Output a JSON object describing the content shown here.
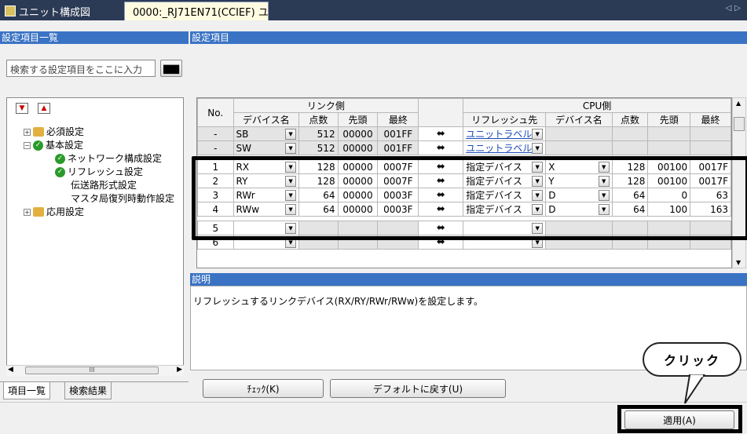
{
  "tabs": [
    {
      "label": "ユニット構成図"
    },
    {
      "label": "0000:_RJ71EN71(CCIEF) ユ..."
    }
  ],
  "left": {
    "header": "設定項目一覧",
    "search_placeholder": "検索する設定項目をここに入力",
    "tree": [
      {
        "label": "必須設定"
      },
      {
        "label": "基本設定"
      },
      {
        "label": "ネットワーク構成設定"
      },
      {
        "label": "リフレッシュ設定"
      },
      {
        "label": "伝送路形式設定"
      },
      {
        "label": "マスタ局復列時動作設定"
      },
      {
        "label": "応用設定"
      }
    ],
    "bottom_tabs": [
      "項目一覧",
      "検索結果"
    ],
    "hscroll_label": "III"
  },
  "right": {
    "header": "設定項目",
    "table": {
      "no_header": "No.",
      "link_header": "リンク側",
      "cpu_header": "CPU側",
      "sub_headers": [
        "デバイス名",
        "点数",
        "先頭",
        "最終",
        "リフレッシュ先",
        "デバイス名",
        "点数",
        "先頭",
        "最終"
      ],
      "fixed_rows": [
        {
          "no": "-",
          "dev": "SB",
          "pts": "512",
          "start": "00000",
          "end": "001FF",
          "dest": "ユニットラベル"
        },
        {
          "no": "-",
          "dev": "SW",
          "pts": "512",
          "start": "00000",
          "end": "001FF",
          "dest": "ユニットラベル"
        }
      ],
      "rows": [
        {
          "no": "1",
          "dev": "RX",
          "pts": "128",
          "start": "00000",
          "end": "0007F",
          "dest": "指定デバイス",
          "cdev": "X",
          "cpts": "128",
          "cstart": "00100",
          "cend": "0017F"
        },
        {
          "no": "2",
          "dev": "RY",
          "pts": "128",
          "start": "00000",
          "end": "0007F",
          "dest": "指定デバイス",
          "cdev": "Y",
          "cpts": "128",
          "cstart": "00100",
          "cend": "0017F"
        },
        {
          "no": "3",
          "dev": "RWr",
          "pts": "64",
          "start": "00000",
          "end": "0003F",
          "dest": "指定デバイス",
          "cdev": "D",
          "cpts": "64",
          "cstart": "0",
          "cend": "63"
        },
        {
          "no": "4",
          "dev": "RWw",
          "pts": "64",
          "start": "00000",
          "end": "0003F",
          "dest": "指定デバイス",
          "cdev": "D",
          "cpts": "64",
          "cstart": "100",
          "cend": "163"
        }
      ],
      "extra_rows": [
        {
          "no": "5"
        },
        {
          "no": "6"
        }
      ]
    },
    "desc_header": "説明",
    "desc_text": "リフレッシュするリンクデバイス(RX/RY/RWr/RWw)を設定します。",
    "check_button": "ﾁｪｯｸ(K)",
    "default_button": "デフォルトに戻す(U)"
  },
  "apply_button": "適用(A)",
  "callout": "クリック",
  "colors": {
    "header_bg": "#3a73c4",
    "tab_bar": "#2b3a55",
    "check_green": "#2a9b2a"
  }
}
